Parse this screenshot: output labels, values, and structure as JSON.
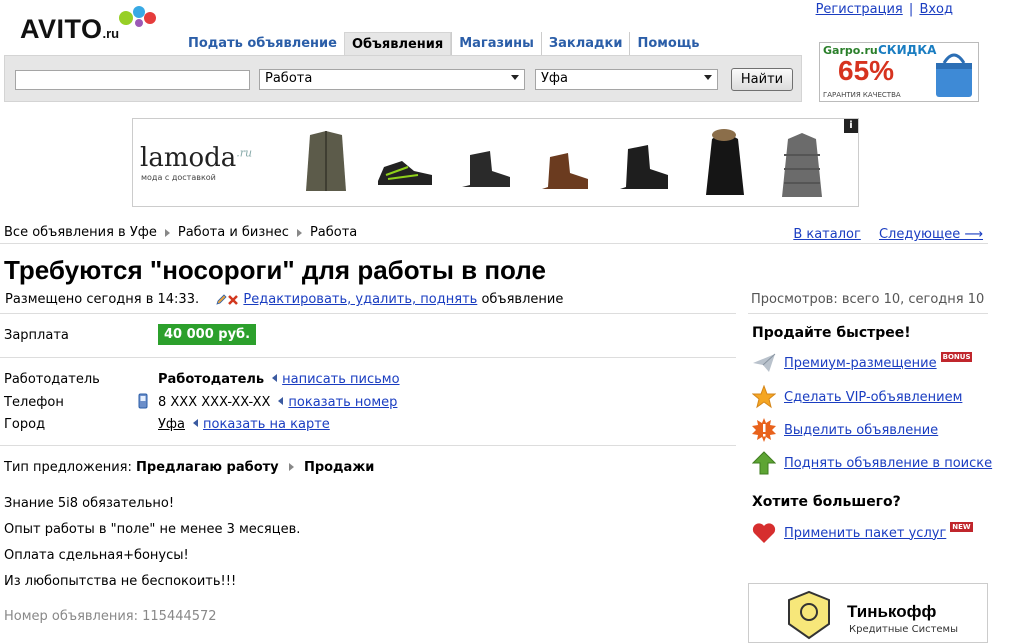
{
  "header": {
    "logo_text": "AVITO",
    "logo_suffix": ".ru",
    "register": "Регистрация",
    "separator": "|",
    "login": "Вход"
  },
  "nav": {
    "tabs": [
      {
        "label": "Подать объявление",
        "active": false
      },
      {
        "label": "Объявления",
        "active": true
      },
      {
        "label": "Магазины",
        "active": false
      },
      {
        "label": "Закладки",
        "active": false
      },
      {
        "label": "Помощь",
        "active": false
      }
    ]
  },
  "search": {
    "query": "",
    "category": "Работа",
    "city": "Уфа",
    "button": "Найти"
  },
  "ad_garpo": {
    "brand": "Garpo.ru",
    "discount_label": "СКИДКА",
    "percent": "65%",
    "guarantee": "ГАРАНТИЯ КАЧЕСТВА"
  },
  "ad_lamoda": {
    "logo": "lamoda",
    "logo_suffix": ".ru",
    "tagline": "мода с доставкой",
    "info": "i"
  },
  "breadcrumbs": [
    "Все объявления в Уфе",
    "Работа и бизнес",
    "Работа"
  ],
  "crumb_nav": {
    "catalog": "В каталог",
    "next": "Следующее ⟶"
  },
  "listing": {
    "title": "Требуются \"носороги\" для работы в поле",
    "posted": "Размещено сегодня в 14:33.",
    "edit_link": "Редактировать, удалить, поднять",
    "edit_suffix": "объявление",
    "salary_label": "Зарплата",
    "salary_value": "40 000 руб.",
    "employer_label": "Работодатель",
    "employer_value": "Работодатель",
    "employer_action": "написать письмо",
    "phone_label": "Телефон",
    "phone_value": "8 XXX XXX-XX-XX",
    "phone_action": "показать номер",
    "city_label": "Город",
    "city_value": "Уфа",
    "city_action": "показать на карте",
    "offer_type_label": "Тип предложения:",
    "offer_type_value": "Предлагаю работу",
    "offer_category": "Продажи",
    "description": [
      "Знание 5i8 обязательно!",
      "Опыт работы в \"поле\" не менее 3 месяцев.",
      "Оплата сдельная+бонусы!",
      "Из любопытства не беспокоить!!!"
    ],
    "ad_number": "Номер объявления: 115444572"
  },
  "sidebar": {
    "views": "Просмотров: всего 10, сегодня 10",
    "sell_faster_title": "Продайте быстрее!",
    "actions": [
      {
        "label": "Премиум-размещение",
        "icon": "paper-plane-icon",
        "badge": "BONUS"
      },
      {
        "label": "Сделать VIP-объявлением",
        "icon": "star-icon",
        "badge": ""
      },
      {
        "label": "Выделить объявление",
        "icon": "highlight-burst-icon",
        "badge": ""
      },
      {
        "label": "Поднять объявление в поиске",
        "icon": "arrow-up-icon",
        "badge": ""
      }
    ],
    "more_title": "Хотите большего?",
    "package": {
      "label": "Применить пакет услуг",
      "icon": "heart-icon",
      "badge": "NEW"
    }
  },
  "ad_tinkoff": {
    "name": "Тинькофф",
    "subtitle": "Кредитные Системы"
  },
  "colors": {
    "link": "#1a3dc1",
    "salary_bg": "#2ca02c",
    "badge": "#c0262c",
    "nav_text": "#2b5ea8"
  }
}
